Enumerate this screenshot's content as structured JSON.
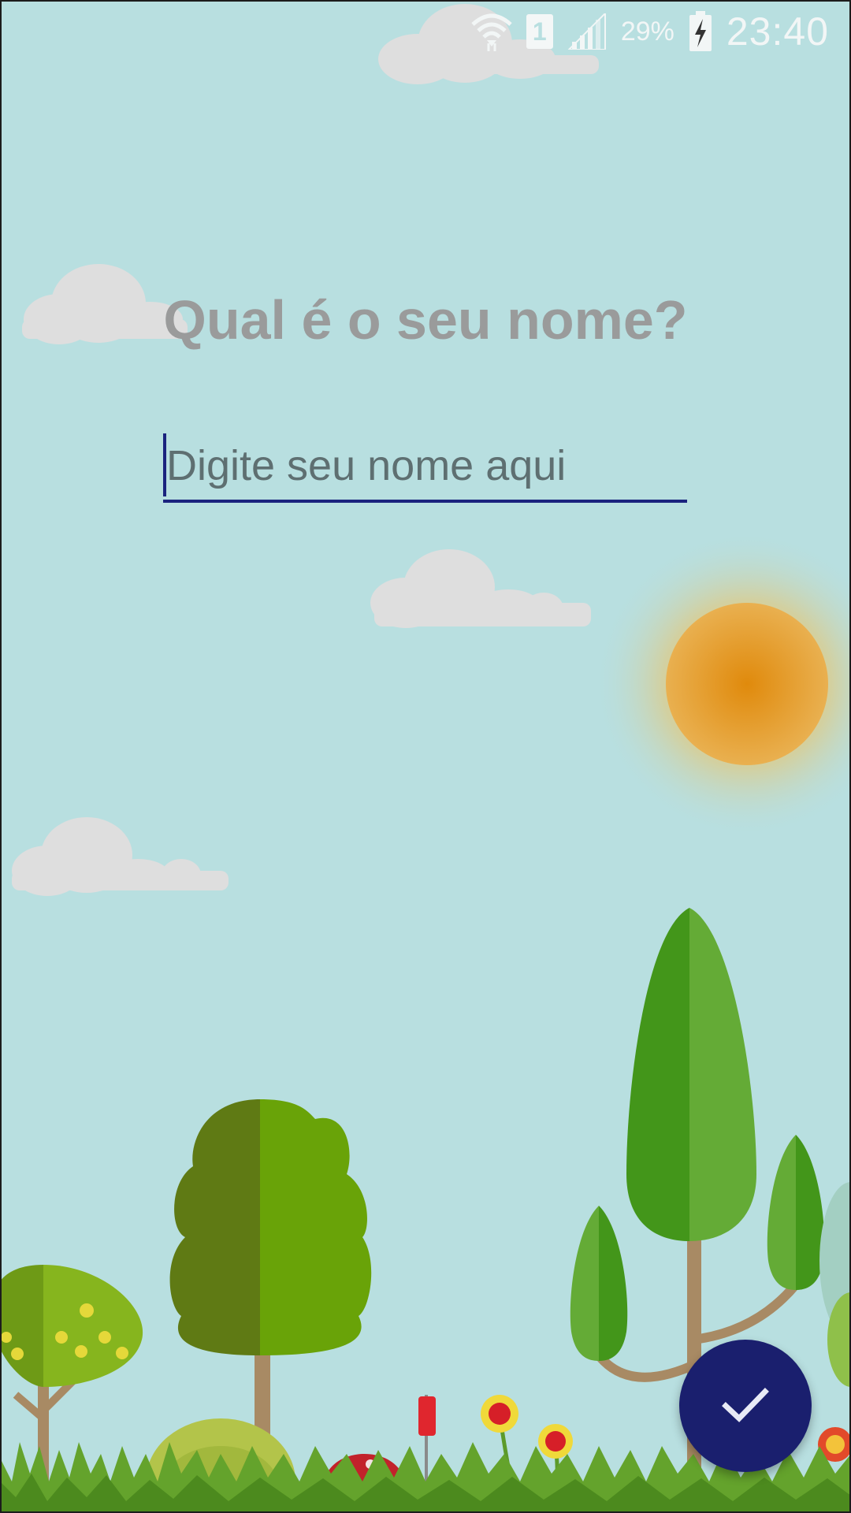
{
  "status_bar": {
    "battery_percent": "29%",
    "clock": "23:40",
    "sim_slot": "1",
    "icons": [
      "wifi-icon",
      "sim-icon",
      "signal-icon",
      "battery-charging-icon"
    ]
  },
  "main": {
    "question": "Qual é o seu nome?",
    "name_input": {
      "placeholder": "Digite seu nome aqui",
      "value": ""
    },
    "confirm_button": {
      "icon": "check-icon"
    }
  },
  "colors": {
    "sky": "#b8dfe0",
    "accent": "#1a237e",
    "sun": "#e8a73a",
    "cloud": "#dedede"
  }
}
